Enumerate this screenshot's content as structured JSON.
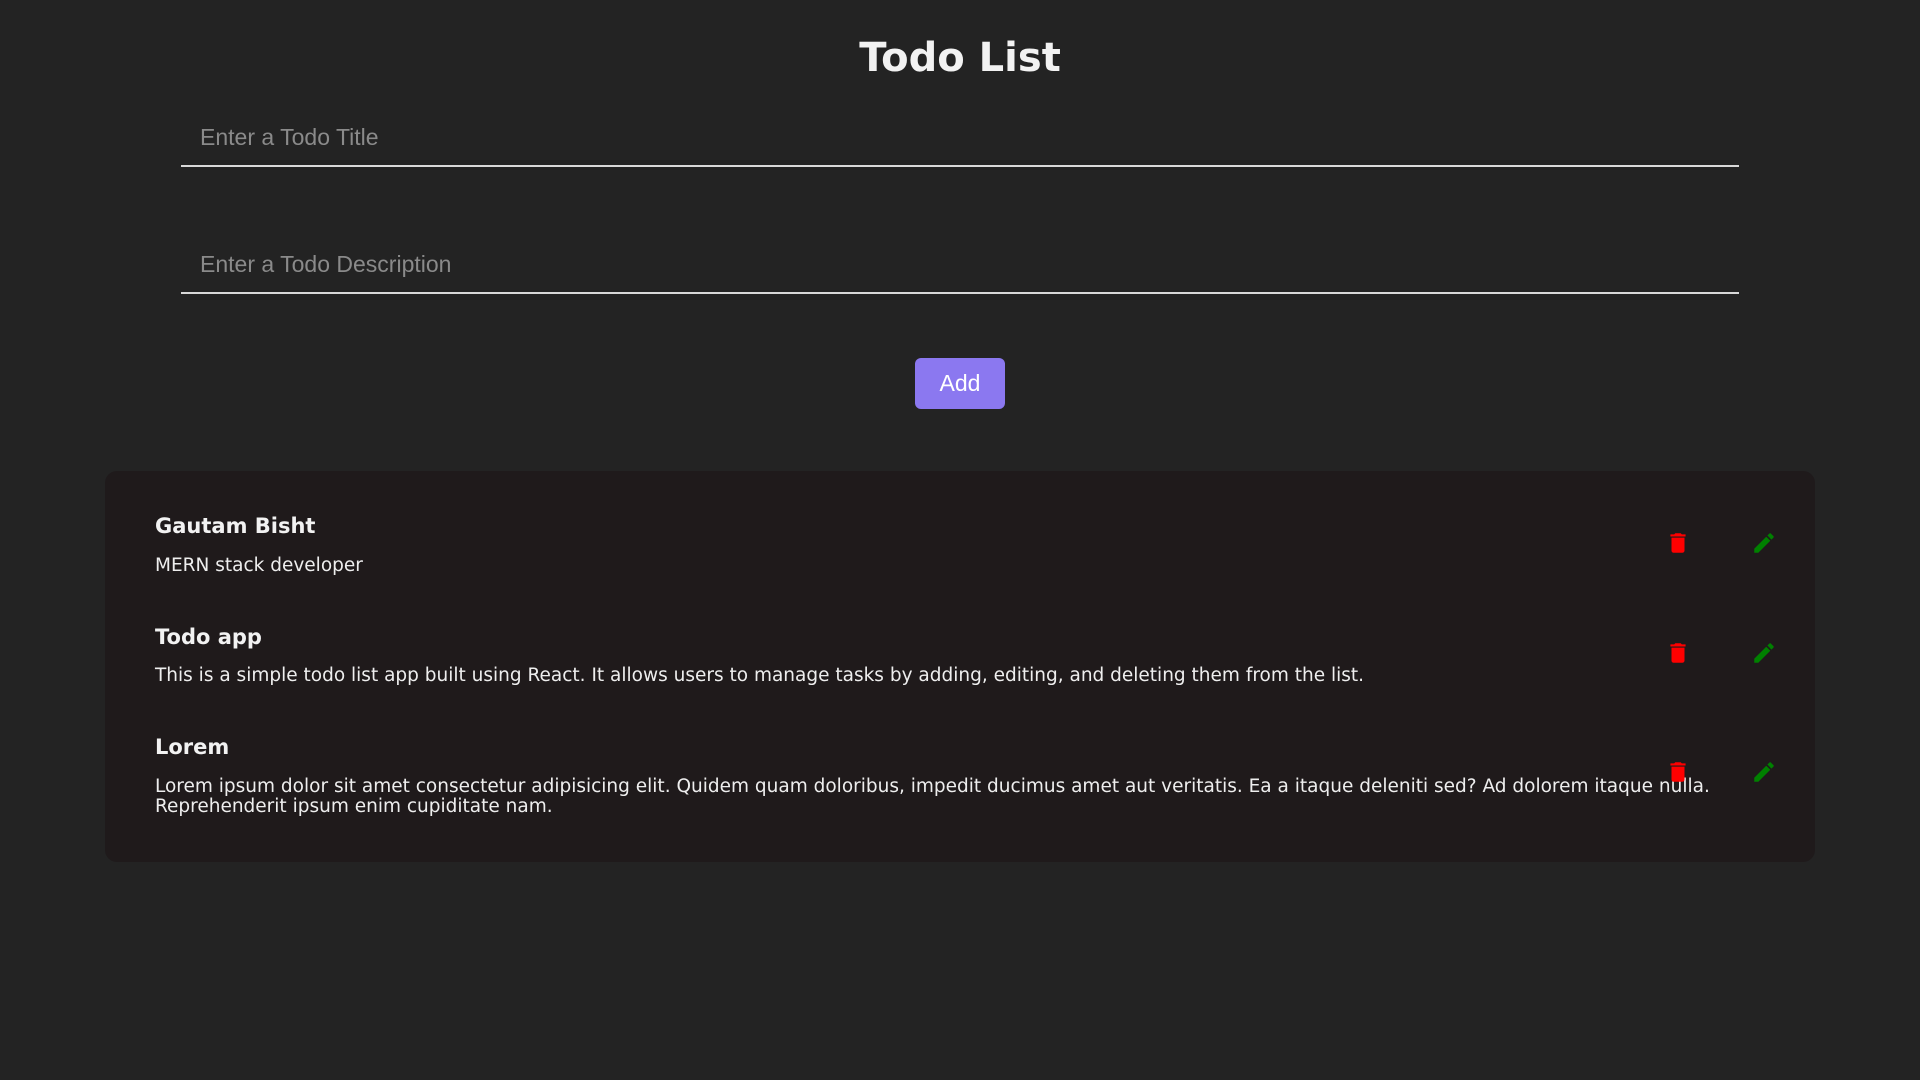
{
  "header": {
    "title": "Todo List"
  },
  "form": {
    "title_placeholder": "Enter a Todo Title",
    "title_value": "",
    "description_placeholder": "Enter a Todo Description",
    "description_value": "",
    "add_label": "Add"
  },
  "todos": [
    {
      "title": "Gautam Bisht",
      "description": "MERN stack developer",
      "delete_icon": "trash-icon",
      "edit_icon": "pencil-icon"
    },
    {
      "title": "Todo app",
      "description": "This is a simple todo list app built using React. It allows users to manage tasks by adding, editing, and deleting them from the list.",
      "delete_icon": "trash-icon",
      "edit_icon": "pencil-icon"
    },
    {
      "title": "Lorem",
      "description": "Lorem ipsum dolor sit amet consectetur adipisicing elit. Quidem quam doloribus, impedit ducimus amet aut veritatis. Ea a itaque deleniti sed? Ad dolorem itaque nulla. Reprehenderit ipsum enim cupiditate nam.",
      "delete_icon": "trash-icon",
      "edit_icon": "pencil-icon"
    }
  ],
  "colors": {
    "background": "#232323",
    "panel": "#1f1a1b",
    "accent": "#8b78f0",
    "delete": "#ff0000",
    "edit": "#008000"
  }
}
